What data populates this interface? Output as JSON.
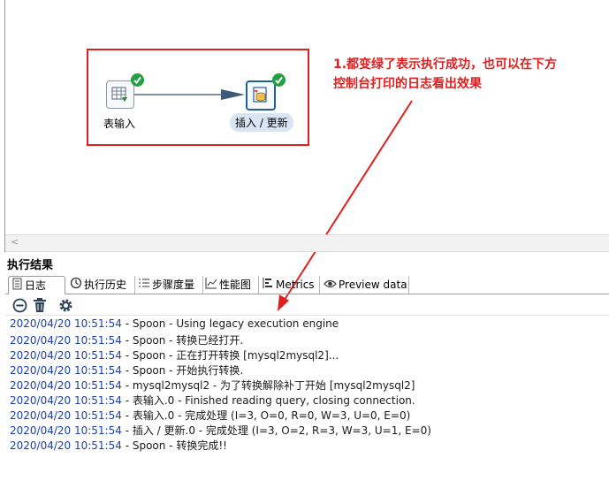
{
  "canvas": {
    "steps": [
      {
        "label": "表输入",
        "icon": "table-input-icon",
        "status": "success"
      },
      {
        "label": "插入 / 更新",
        "icon": "insert-update-icon",
        "status": "success"
      }
    ],
    "note_lines": [
      "1.都变绿了表示执行成功，也可以在下方",
      "控制台打印的日志看出效果"
    ],
    "highlight_color": "#e02020",
    "success_color": "#22a043"
  },
  "panel": {
    "title": "执行结果",
    "tabs": [
      {
        "label": "日志",
        "icon": "log-icon",
        "active": true
      },
      {
        "label": "执行历史",
        "icon": "history-icon"
      },
      {
        "label": "步骤度量",
        "icon": "step-metrics-icon"
      },
      {
        "label": "性能图",
        "icon": "performance-chart-icon"
      },
      {
        "label": "Metrics",
        "icon": "metrics-icon"
      },
      {
        "label": "Preview data",
        "icon": "eye-icon"
      }
    ],
    "toolbar": [
      "stop-icon",
      "trash-icon",
      "settings-icon"
    ]
  },
  "log": [
    {
      "time": "2020/04/20 10:51:54",
      "text": " - Spoon - Using legacy execution engine"
    },
    {
      "time": "2020/04/20 10:51:54",
      "text": " - Spoon - 转换已经打开."
    },
    {
      "time": "2020/04/20 10:51:54",
      "text": " - Spoon - 正在打开转换 [mysql2mysql2]..."
    },
    {
      "time": "2020/04/20 10:51:54",
      "text": " - Spoon - 开始执行转换."
    },
    {
      "time": "2020/04/20 10:51:54",
      "text": " - mysql2mysql2 - 为了转换解除补丁开始  [mysql2mysql2]"
    },
    {
      "time": "2020/04/20 10:51:54",
      "text": " - 表输入.0 - Finished reading query, closing connection."
    },
    {
      "time": "2020/04/20 10:51:54",
      "text": " - 表输入.0 - 完成处理 (I=3, O=0, R=0, W=3, U=0, E=0)"
    },
    {
      "time": "2020/04/20 10:51:54",
      "text": " - 插入 / 更新.0 - 完成处理 (I=3, O=2, R=3, W=3, U=1, E=0)"
    },
    {
      "time": "2020/04/20 10:51:54",
      "text": " - Spoon - 转换完成!!"
    }
  ]
}
